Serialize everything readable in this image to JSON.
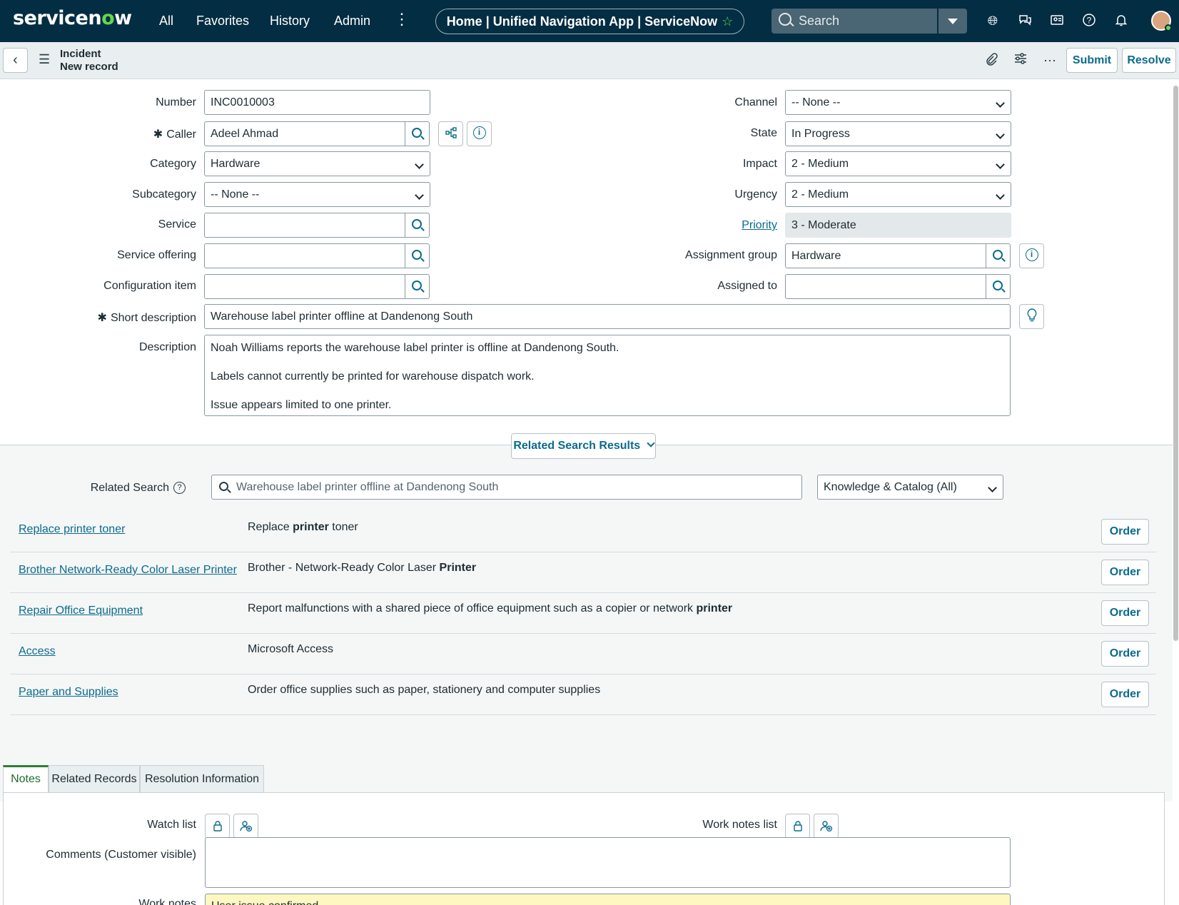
{
  "topbar": {
    "logo_pre": "servicen",
    "logo_o": "o",
    "logo_post": "w",
    "nav": [
      "All",
      "Favorites",
      "History",
      "Admin"
    ],
    "title": "Home | Unified Navigation App | ServiceNow",
    "search_placeholder": "Search"
  },
  "subbar": {
    "record_type": "Incident",
    "record_state": "New record",
    "submit_label": "Submit",
    "resolve_label": "Resolve"
  },
  "form": {
    "number_label": "Number",
    "number_value": "INC0010003",
    "caller_label": "Caller",
    "caller_value": "Adeel Ahmad",
    "category_label": "Category",
    "category_value": "Hardware",
    "subcategory_label": "Subcategory",
    "subcategory_value": "-- None --",
    "service_label": "Service",
    "service_value": "",
    "service_offering_label": "Service offering",
    "service_offering_value": "",
    "ci_label": "Configuration item",
    "ci_value": "",
    "short_desc_label": "Short description",
    "short_desc_value": "Warehouse label printer offline at Dandenong South",
    "description_label": "Description",
    "description_value": "Noah Williams reports the warehouse label printer is offline at Dandenong South.\n\nLabels cannot currently be printed for warehouse dispatch work.\n\nIssue appears limited to one printer.",
    "channel_label": "Channel",
    "channel_value": "-- None --",
    "state_label": "State",
    "state_value": "In Progress",
    "impact_label": "Impact",
    "impact_value": "2 - Medium",
    "urgency_label": "Urgency",
    "urgency_value": "2 - Medium",
    "priority_label": "Priority",
    "priority_value": "3 - Moderate",
    "assignment_group_label": "Assignment group",
    "assignment_group_value": "Hardware",
    "assigned_to_label": "Assigned to",
    "assigned_to_value": ""
  },
  "related": {
    "toggle_label": "Related Search Results",
    "search_label": "Related Search",
    "search_value": "Warehouse label printer offline at Dandenong South",
    "source_value": "Knowledge & Catalog (All)",
    "order_label": "Order",
    "results": [
      {
        "title": "Replace printer toner",
        "pre": "Replace ",
        "bold": "printer",
        "post": " toner"
      },
      {
        "title": "Brother Network-Ready Color Laser Printer",
        "pre": "Brother - Network-Ready Color Laser ",
        "bold": "Printer",
        "post": ""
      },
      {
        "title": "Repair Office Equipment",
        "pre": "Report malfunctions with a shared piece of office equipment such as a copier or network ",
        "bold": "printer",
        "post": ""
      },
      {
        "title": "Access",
        "pre": "Microsoft Access",
        "bold": "",
        "post": ""
      },
      {
        "title": "Paper and Supplies",
        "pre": "Order office supplies such as paper, stationery and computer supplies",
        "bold": "",
        "post": ""
      }
    ]
  },
  "tabs": [
    "Notes",
    "Related Records",
    "Resolution Information"
  ],
  "notes": {
    "watch_list_label": "Watch list",
    "work_notes_list_label": "Work notes list",
    "comments_label": "Comments (Customer visible)",
    "work_notes_label": "Work notes",
    "work_notes_value": "User issue confirmed"
  },
  "colors": {
    "header_bg": "#032d42",
    "accent": "#62d84e",
    "link": "#0a6b8d"
  }
}
